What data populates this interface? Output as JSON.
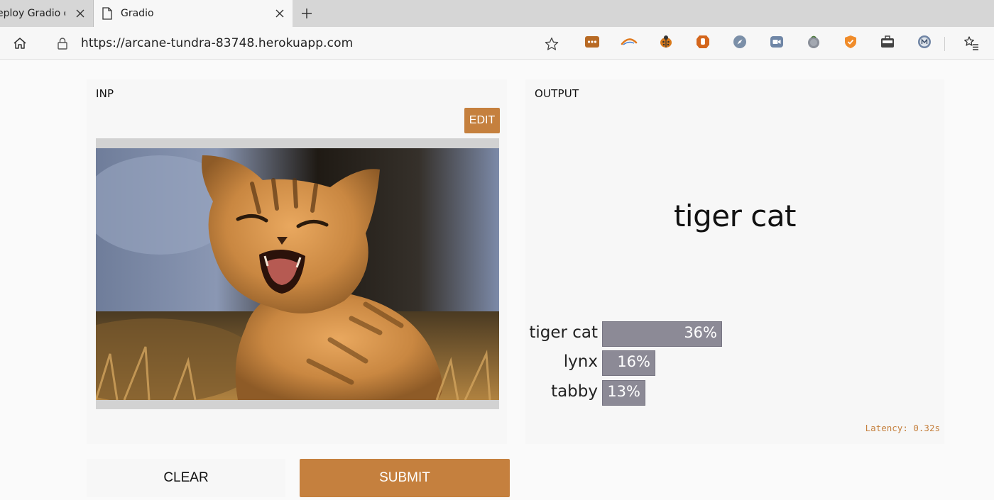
{
  "browser": {
    "tabs": [
      {
        "label": "eploy Gradio o",
        "active": false
      },
      {
        "label": "Gradio",
        "active": true
      }
    ],
    "url": "https://arcane-tundra-83748.herokuapp.com",
    "extensions": [
      "menu-dots-icon",
      "swoosh-icon",
      "ladybug-icon",
      "shield-hand-icon",
      "compass-icon",
      "camera-icon",
      "tomato-icon",
      "shield-badge-icon",
      "briefcase-icon",
      "m-circle-icon"
    ]
  },
  "input": {
    "title": "INP",
    "edit_label": "EDIT"
  },
  "output": {
    "title": "OUTPUT",
    "prediction": "tiger cat",
    "confidences": [
      {
        "label": "tiger cat",
        "value": "36%",
        "fraction": 0.36
      },
      {
        "label": "lynx",
        "value": "16%",
        "fraction": 0.16
      },
      {
        "label": "tabby",
        "value": "13%",
        "fraction": 0.13
      }
    ],
    "latency": "Latency: 0.32s"
  },
  "buttons": {
    "clear": "CLEAR",
    "submit": "SUBMIT"
  },
  "colors": {
    "accent": "#c5803e",
    "bar": "#8c8a96"
  }
}
